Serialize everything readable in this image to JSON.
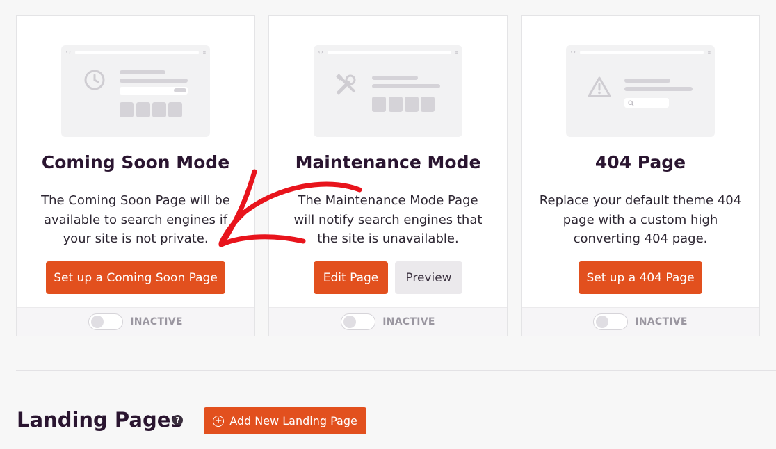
{
  "cards": [
    {
      "title": "Coming Soon Mode",
      "description": "The Coming Soon Page will be available to search engines if your site is not private.",
      "primary_button": "Set up a Coming Soon Page",
      "status": "INACTIVE",
      "illustration_icon": "clock-icon"
    },
    {
      "title": "Maintenance Mode",
      "description": "The Maintenance Mode Page will notify search engines that the site is unavailable.",
      "primary_button": "Edit Page",
      "secondary_button": "Preview",
      "status": "INACTIVE",
      "illustration_icon": "tools-icon"
    },
    {
      "title": "404 Page",
      "description": "Replace your default theme 404 page with a custom high converting 404 page.",
      "primary_button": "Set up a 404 Page",
      "status": "INACTIVE",
      "illustration_icon": "warning-icon"
    }
  ],
  "landing": {
    "title": "Landing Pages",
    "help_icon": "question-icon",
    "add_button": "Add New Landing Page"
  },
  "colors": {
    "accent": "#e2501e",
    "annotation_arrow": "#e8141c"
  }
}
